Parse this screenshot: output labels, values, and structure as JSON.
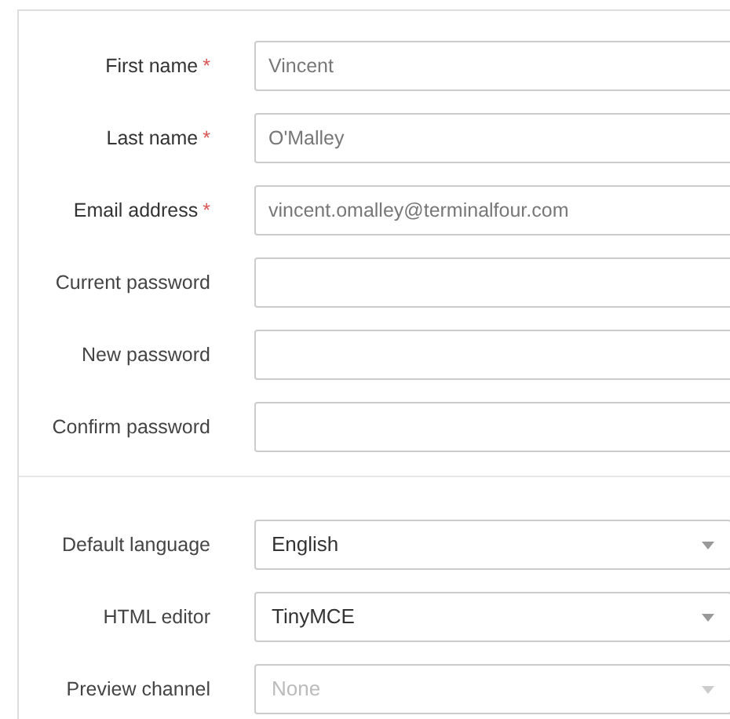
{
  "account_fields": [
    {
      "kind": "text",
      "label": "First name",
      "required_mark": "*",
      "value": "Vincent"
    },
    {
      "kind": "text",
      "label": "Last name",
      "required_mark": "*",
      "value": "O'Malley"
    },
    {
      "kind": "text",
      "label": "Email address",
      "required_mark": "*",
      "value": "vincent.omalley@terminalfour.com"
    },
    {
      "kind": "password",
      "label": "Current password"
    },
    {
      "kind": "password",
      "label": "New password"
    },
    {
      "kind": "password",
      "label": "Confirm password"
    }
  ],
  "preference_fields": [
    {
      "kind": "select",
      "label": "Default language",
      "value": "English",
      "disabled": false
    },
    {
      "kind": "select",
      "label": "HTML editor",
      "value": "TinyMCE",
      "disabled": false
    },
    {
      "kind": "select",
      "label": "Preview channel",
      "value": "None",
      "disabled": true
    }
  ]
}
